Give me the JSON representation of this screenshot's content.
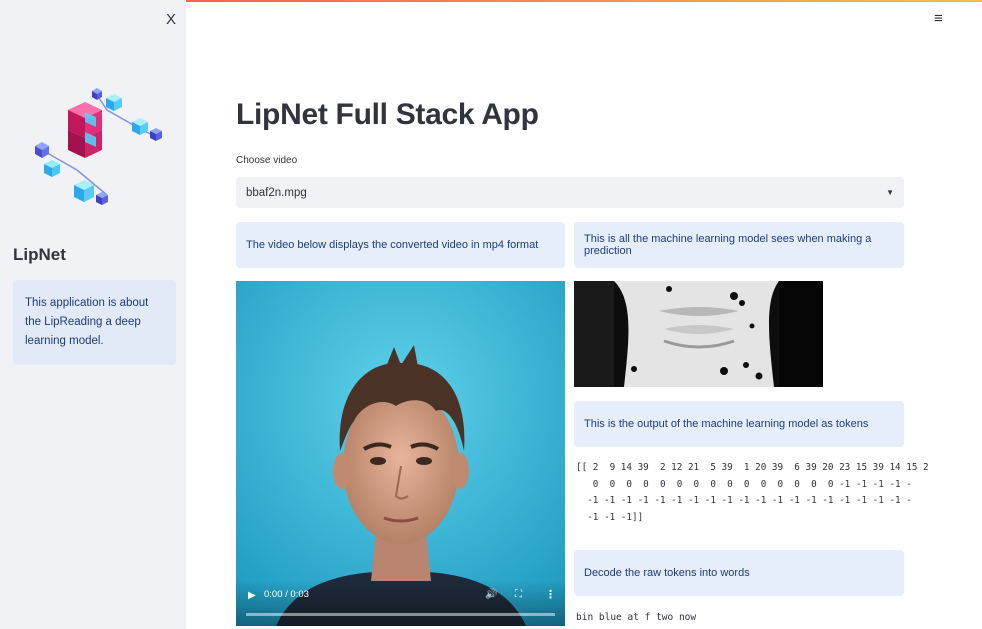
{
  "sidebar": {
    "close_label": "X",
    "title": "LipNet",
    "info_text": "This application is about the LipReading a deep learning model.",
    "logo_icon": "cube-network-logo"
  },
  "header": {
    "menu_icon": "hamburger-menu-icon",
    "menu_label": "≡"
  },
  "main": {
    "title": "LipNet Full Stack App",
    "select_label": "Choose video",
    "select_value": "bbaf2n.mpg",
    "card_video": "The video below displays the converted video in mp4 format",
    "card_model": "This is all the machine learning model sees when making a prediction",
    "card_tokens": "This is the output of the machine learning model as tokens",
    "card_decode": "Decode the raw tokens into words",
    "tokens_output": "[[ 2  9 14 39  2 12 21  5 39  1 20 39  6 39 20 23 15 39 14 15 2\n   0  0  0  0  0  0  0  0  0  0  0  0  0  0  0 -1 -1 -1 -1 -\n  -1 -1 -1 -1 -1 -1 -1 -1 -1 -1 -1 -1 -1 -1 -1 -1 -1 -1 -1 -\n  -1 -1 -1]]",
    "decoded_output": "bin blue at f two now"
  },
  "video_player": {
    "time": "0:00 / 0:03",
    "progress": 0,
    "play_label": "▶",
    "volume_label": "🔊",
    "fullscreen_label": "⛶",
    "more_label": "⋮"
  },
  "colors": {
    "accent": "#ff4b4b",
    "sidebar_bg": "#f0f2f6",
    "info_bg": "#e6eefb",
    "info_text": "#1c3d7a"
  }
}
